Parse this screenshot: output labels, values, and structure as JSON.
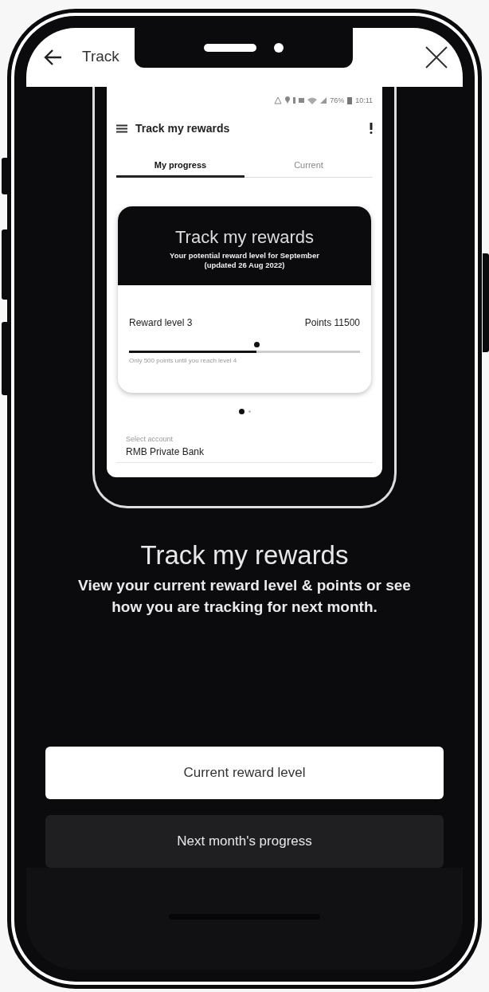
{
  "header": {
    "title": "Track"
  },
  "preview": {
    "status": {
      "battery": "76%",
      "time": "10:11"
    },
    "app_bar": {
      "title": "Track my rewards"
    },
    "tabs": [
      {
        "label": "My progress",
        "selected": true
      },
      {
        "label": "Current",
        "selected": false
      }
    ],
    "card": {
      "title": "Track my rewards",
      "subtitle": "Your potential reward level for September",
      "updated": "(updated 26 Aug 2022)",
      "level_label": "Reward level 3",
      "points_label": "Points 11500",
      "progress": {
        "level": 0.55
      },
      "hint": "Only 500 points until you reach level 4"
    },
    "pager": [
      {
        "selected": true
      },
      {
        "selected": false
      }
    ],
    "account": {
      "label": "Select account",
      "value": "RMB Private Bank"
    }
  },
  "title": "Track my rewards",
  "description": "View your current reward level & points or see how you are tracking for next month.",
  "options": [
    {
      "label": "Current reward level",
      "selected": true
    },
    {
      "label": "Next month's progress",
      "selected": false
    }
  ]
}
